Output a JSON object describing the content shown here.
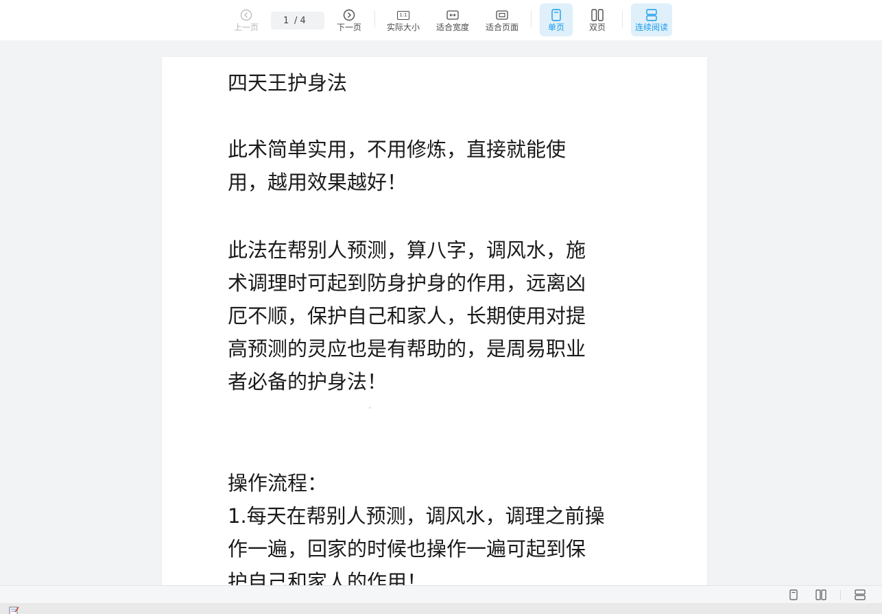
{
  "toolbar": {
    "prev_label": "上一页",
    "next_label": "下一页",
    "page_current": "1",
    "page_total": "/ 4",
    "actual_size_label": "实际大小",
    "actual_size_icon_text": "1:1",
    "fit_width_label": "适合宽度",
    "fit_page_label": "适合页面",
    "single_page_label": "单页",
    "double_page_label": "双页",
    "continuous_label": "连续阅读",
    "active_mode": "single+continuous",
    "accent_color": "#1a9be8"
  },
  "document": {
    "title": "四天王护身法",
    "para1": "此术简单实用，不用修炼，直接就能使\n用，越用效果越好！",
    "para2": "此法在帮别人预测，算八字，调风水，施\n术调理时可起到防身护身的作用，远离凶\n厄不顺，保护自己和家人，长期使用对提\n高预测的灵应也是有帮助的，是周易职业\n者必备的护身法！",
    "heading": "操作流程：",
    "para3": "1.每天在帮别人预测，调风水，调理之前操\n作一遍，回家的时候也操作一遍可起到保\n护自己和家人的作用！"
  }
}
